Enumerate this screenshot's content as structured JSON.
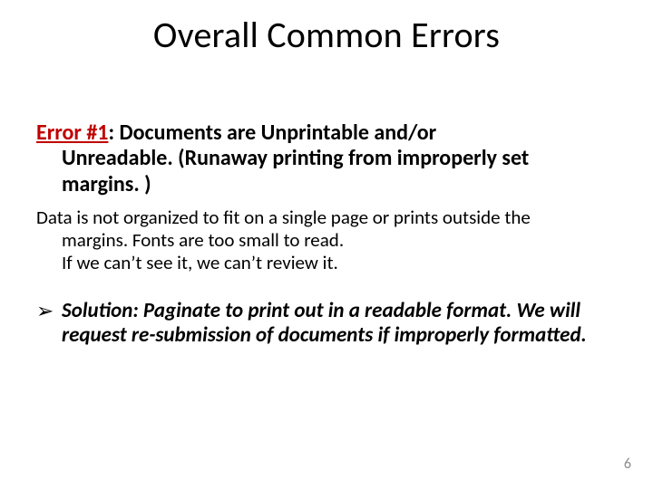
{
  "title": "Overall Common Errors",
  "error": {
    "label": "Error #1",
    "heading_line1": ":  Documents are Unprintable and/or",
    "heading_line2": "Unreadable. (Runaway printing from improperly set",
    "heading_line3": "margins. )"
  },
  "body": {
    "line1": "Data is not organized to fit on a single page or prints outside the",
    "line2": "margins.  Fonts are too small to read.",
    "line3": "If we can’t see it, we can’t review it."
  },
  "solution": {
    "bullet": "➢",
    "line1": "Solution:  Paginate to print out in a readable format. We will",
    "line2": "request re-submission of documents if improperly formatted."
  },
  "page_number": "6"
}
